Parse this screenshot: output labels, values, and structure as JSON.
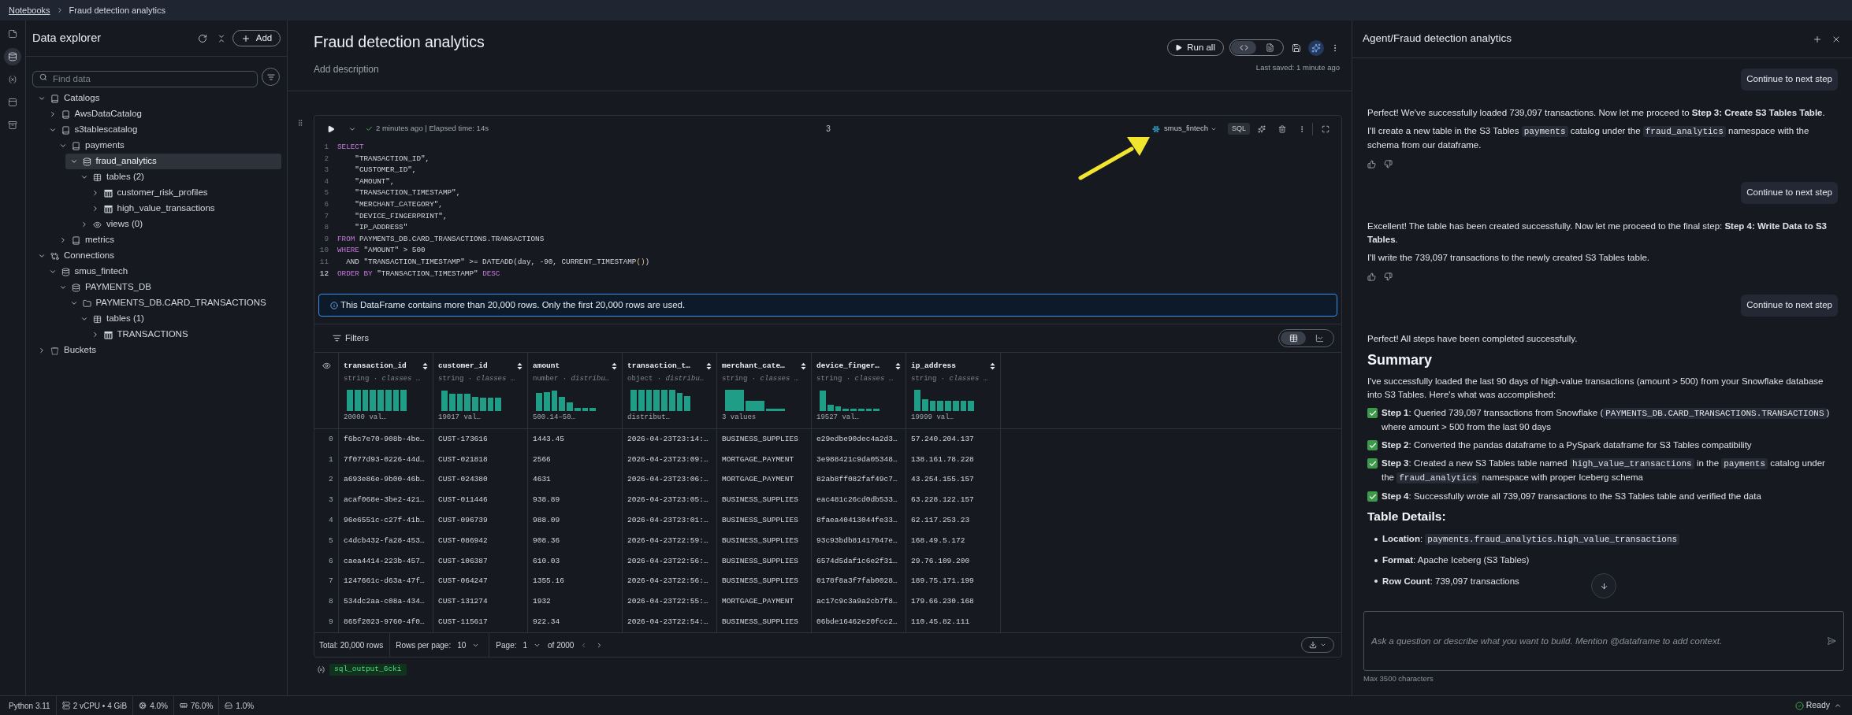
{
  "breadcrumb": [
    {
      "kind": "link",
      "label": "Notebooks"
    },
    {
      "kind": "current",
      "label": "Fraud detection analytics"
    }
  ],
  "rail": [
    {
      "selected": false
    },
    {
      "selected": true
    },
    {
      "selected": false
    },
    {
      "selected": false
    },
    {
      "selected": false
    }
  ],
  "explorer": {
    "title": "Data explorer",
    "add_button": "Add",
    "search": {
      "placeholder": "Find data"
    },
    "tree": [
      {
        "kind": "catalog",
        "label": "Catalogs",
        "expanded": true,
        "selected": false,
        "children": [
          {
            "kind": "catalog",
            "label": "AwsDataCatalog",
            "expanded": false,
            "selected": false
          },
          {
            "kind": "catalog",
            "label": "s3tablescatalog",
            "expanded": true,
            "selected": false,
            "children": [
              {
                "kind": "catalog",
                "label": "payments",
                "expanded": true,
                "selected": false,
                "children": [
                  {
                    "kind": "database",
                    "label": "fraud_analytics",
                    "expanded": true,
                    "selected": true,
                    "children": [
                      {
                        "kind": "table-group",
                        "label": "tables (2)",
                        "expanded": true,
                        "selected": false,
                        "children": [
                          {
                            "kind": "table",
                            "label": "customer_risk_profiles",
                            "expanded": false,
                            "selected": false
                          },
                          {
                            "kind": "table",
                            "label": "high_value_transactions",
                            "expanded": false,
                            "selected": false
                          }
                        ]
                      },
                      {
                        "kind": "view-group",
                        "label": "views (0)",
                        "expanded": false,
                        "selected": false
                      }
                    ]
                  }
                ]
              },
              {
                "kind": "catalog",
                "label": "metrics",
                "expanded": false,
                "selected": false
              }
            ]
          }
        ]
      },
      {
        "kind": "connection-group",
        "label": "Connections",
        "expanded": true,
        "selected": false,
        "children": [
          {
            "kind": "database",
            "label": "smus_fintech",
            "expanded": true,
            "selected": false,
            "children": [
              {
                "kind": "database",
                "label": "PAYMENTS_DB",
                "expanded": true,
                "selected": false,
                "children": [
                  {
                    "kind": "schema",
                    "label": "PAYMENTS_DB.CARD_TRANSACTIONS",
                    "expanded": true,
                    "selected": false,
                    "children": [
                      {
                        "kind": "table-group",
                        "label": "tables (1)",
                        "expanded": true,
                        "selected": false,
                        "children": [
                          {
                            "kind": "table",
                            "label": "TRANSACTIONS",
                            "expanded": false,
                            "selected": false
                          }
                        ]
                      }
                    ]
                  }
                ]
              }
            ]
          }
        ]
      },
      {
        "kind": "bucket-group",
        "label": "Buckets",
        "expanded": false,
        "selected": false
      }
    ]
  },
  "notebook": {
    "title": "Fraud detection analytics",
    "add_description": "Add description",
    "run_all": "Run all",
    "view_modes": [
      {
        "kind": "code",
        "selected": true
      },
      {
        "kind": "document",
        "selected": false
      }
    ],
    "last_saved": "Last saved: 1 minute ago",
    "cell": {
      "status": "2 minutes ago | Elapsed time: 14s",
      "execution_count": "3",
      "connection": "smus_fintech",
      "language": "SQL",
      "code": [
        {
          "number": "1",
          "active": false,
          "tokens": [
            {
              "kind": "keyword",
              "text": "SELECT"
            }
          ]
        },
        {
          "number": "2",
          "active": false,
          "tokens": [
            {
              "kind": "plain",
              "text": "    \"TRANSACTION_ID\","
            }
          ]
        },
        {
          "number": "3",
          "active": false,
          "tokens": [
            {
              "kind": "plain",
              "text": "    \"CUSTOMER_ID\","
            }
          ]
        },
        {
          "number": "4",
          "active": false,
          "tokens": [
            {
              "kind": "plain",
              "text": "    \"AMOUNT\","
            }
          ]
        },
        {
          "number": "5",
          "active": false,
          "tokens": [
            {
              "kind": "plain",
              "text": "    \"TRANSACTION_TIMESTAMP\","
            }
          ]
        },
        {
          "number": "6",
          "active": false,
          "tokens": [
            {
              "kind": "plain",
              "text": "    \"MERCHANT_CATEGORY\","
            }
          ]
        },
        {
          "number": "7",
          "active": false,
          "tokens": [
            {
              "kind": "plain",
              "text": "    \"DEVICE_FINGERPRINT\","
            }
          ]
        },
        {
          "number": "8",
          "active": false,
          "tokens": [
            {
              "kind": "plain",
              "text": "    \"IP_ADDRESS\""
            }
          ]
        },
        {
          "number": "9",
          "active": false,
          "tokens": [
            {
              "kind": "keyword",
              "text": "FROM"
            },
            {
              "kind": "plain",
              "text": " PAYMENTS_DB.CARD_TRANSACTIONS.TRANSACTIONS"
            }
          ]
        },
        {
          "number": "10",
          "active": false,
          "tokens": [
            {
              "kind": "keyword",
              "text": "WHERE"
            },
            {
              "kind": "plain",
              "text": " \"AMOUNT\" > 500"
            }
          ]
        },
        {
          "number": "11",
          "active": false,
          "tokens": [
            {
              "kind": "plain",
              "text": "  AND \"TRANSACTION_TIMESTAMP\" >= DATEADD(day, -90, CURRENT_TIMESTAMP"
            },
            {
              "kind": "bracket",
              "text": "()"
            },
            {
              "kind": "plain",
              "text": ")"
            }
          ]
        },
        {
          "number": "12",
          "active": true,
          "tokens": [
            {
              "kind": "keyword",
              "text": "ORDER BY"
            },
            {
              "kind": "plain",
              "text": " \"TRANSACTION_TIMESTAMP\" "
            },
            {
              "kind": "keyword",
              "text": "DESC"
            }
          ]
        }
      ],
      "banner": "This DataFrame contains more than 20,000 rows. Only the first 20,000 rows are used.",
      "filters": "Filters",
      "output_views": [
        {
          "kind": "table",
          "selected": true
        },
        {
          "kind": "chart",
          "selected": false
        }
      ],
      "columns": [
        {
          "name": "transaction_id",
          "type": "string · *classes* …",
          "summary": "20000 val…"
        },
        {
          "name": "customer_id",
          "type": "string · *classes* …",
          "summary": "19017 val…"
        },
        {
          "name": "amount",
          "type": "number · *distribu…*",
          "summary": "500.14–50…"
        },
        {
          "name": "transaction_t…",
          "type": "object · *distribu…*",
          "summary": "distribut…"
        },
        {
          "name": "merchant_cate…",
          "type": "string · *classes* …",
          "summary": "3 values"
        },
        {
          "name": "device_finger…",
          "type": "string · *classes* …",
          "summary": "19527 val…"
        },
        {
          "name": "ip_address",
          "type": "string · *classes* …",
          "summary": "19999 val…"
        }
      ],
      "rows": [
        {
          "index": "0",
          "cells": [
            "f6bc7e70-908b-4be…",
            "CUST-173616",
            "1443.45",
            "2026-04-23T23:14:…",
            "BUSINESS_SUPPLIES",
            "e29edbe90dec4a2d3…",
            "57.240.204.137"
          ]
        },
        {
          "index": "1",
          "cells": [
            "7f077d93-0226-44d…",
            "CUST-021818",
            "2566",
            "2026-04-23T23:09:…",
            "MORTGAGE_PAYMENT",
            "3e988421c9da05348…",
            "138.161.78.228"
          ]
        },
        {
          "index": "2",
          "cells": [
            "a693e86e-9b00-46b…",
            "CUST-024380",
            "4631",
            "2026-04-23T23:06:…",
            "MORTGAGE_PAYMENT",
            "82ab8ff082faf49c7…",
            "43.254.155.157"
          ]
        },
        {
          "index": "3",
          "cells": [
            "acaf068e-3be2-421…",
            "CUST-011446",
            "938.89",
            "2026-04-23T23:05:…",
            "BUSINESS_SUPPLIES",
            "eac481c26cd0db533…",
            "63.228.122.157"
          ]
        },
        {
          "index": "4",
          "cells": [
            "96e6551c-c27f-41b…",
            "CUST-096739",
            "988.09",
            "2026-04-23T23:01:…",
            "BUSINESS_SUPPLIES",
            "8faea40413044fe33…",
            "62.117.253.23"
          ]
        },
        {
          "index": "5",
          "cells": [
            "c4dcb432-fa28-453…",
            "CUST-086942",
            "908.36",
            "2026-04-23T22:59:…",
            "BUSINESS_SUPPLIES",
            "93c93bdb81417047e…",
            "168.49.5.172"
          ]
        },
        {
          "index": "6",
          "cells": [
            "caea4414-223b-457…",
            "CUST-106387",
            "610.03",
            "2026-04-23T22:56:…",
            "BUSINESS_SUPPLIES",
            "6574d5daf1c6e2f31…",
            "29.76.109.200"
          ]
        },
        {
          "index": "7",
          "cells": [
            "1247661c-d63a-47f…",
            "CUST-064247",
            "1355.16",
            "2026-04-23T22:56:…",
            "BUSINESS_SUPPLIES",
            "0178f8a3f7fab0028…",
            "189.75.171.199"
          ]
        },
        {
          "index": "8",
          "cells": [
            "534dc2aa-c08a-434…",
            "CUST-131274",
            "1932",
            "2026-04-23T22:55:…",
            "MORTGAGE_PAYMENT",
            "ac17c9c3a9a2cb7f8…",
            "179.66.230.168"
          ]
        },
        {
          "index": "9",
          "cells": [
            "865f2023-9760-4f0…",
            "CUST-115617",
            "922.34",
            "2026-04-23T22:54:…",
            "BUSINESS_SUPPLIES",
            "06bde16462e20fcc2…",
            "110.45.82.111"
          ]
        }
      ],
      "footer": {
        "total": "Total: 20,000 rows",
        "rows_per_page_label": "Rows per page:",
        "rows_per_page": "10",
        "page_label": "Page:",
        "page": "1",
        "page_count": "of 2000"
      },
      "output_variable": "sql_output_6cki"
    }
  },
  "agent": {
    "title": "Agent/Fraud detection analytics",
    "messages": [
      {
        "kind": "user",
        "text": "Continue to next step"
      },
      {
        "kind": "assistant",
        "blocks": [
          {
            "kind": "paragraph",
            "segments": [
              {
                "kind": "text",
                "text": "Perfect! We've successfully loaded 739,097 transactions. Now let me proceed to **Step 3: Create S3 Tables Table**."
              }
            ]
          },
          {
            "kind": "paragraph",
            "segments": [
              {
                "kind": "text",
                "text": "I'll create a new table in the S3 Tables "
              },
              {
                "kind": "code",
                "text": "payments"
              },
              {
                "kind": "text",
                "text": " catalog under the "
              },
              {
                "kind": "code",
                "text": "fraud_analytics"
              },
              {
                "kind": "text",
                "text": " namespace with the schema from our dataframe."
              }
            ]
          },
          {
            "kind": "feedback"
          }
        ]
      },
      {
        "kind": "user",
        "text": "Continue to next step"
      },
      {
        "kind": "assistant",
        "blocks": [
          {
            "kind": "paragraph",
            "segments": [
              {
                "kind": "text",
                "text": "Excellent! The table has been created successfully. Now let me proceed to the final step: **Step 4: Write Data to S3 Tables**."
              }
            ]
          },
          {
            "kind": "paragraph",
            "segments": [
              {
                "kind": "text",
                "text": "I'll write the 739,097 transactions to the newly created S3 Tables table."
              }
            ]
          },
          {
            "kind": "feedback"
          }
        ]
      },
      {
        "kind": "user",
        "text": "Continue to next step"
      },
      {
        "kind": "assistant",
        "blocks": [
          {
            "kind": "paragraph",
            "segments": [
              {
                "kind": "text",
                "text": "Perfect! All steps have been completed successfully."
              }
            ]
          },
          {
            "kind": "heading",
            "text": "Summary"
          },
          {
            "kind": "paragraph",
            "segments": [
              {
                "kind": "text",
                "text": "I've successfully loaded the last 90 days of high-value transactions (amount > 500) from your Snowflake database into S3 Tables. Here's what was accomplished:"
              }
            ]
          },
          {
            "kind": "check",
            "segments": [
              {
                "kind": "text",
                "text": "**Step 1**: Queried 739,097 transactions from Snowflake ("
              },
              {
                "kind": "code",
                "text": "PAYMENTS_DB.CARD_TRANSACTIONS.TRANSACTIONS"
              },
              {
                "kind": "text",
                "text": ") where amount > 500 from the last 90 days"
              }
            ]
          },
          {
            "kind": "check",
            "segments": [
              {
                "kind": "text",
                "text": "**Step 2**: Converted the pandas dataframe to a PySpark dataframe for S3 Tables compatibility"
              }
            ]
          },
          {
            "kind": "check",
            "segments": [
              {
                "kind": "text",
                "text": "**Step 3**: Created a new S3 Tables table named "
              },
              {
                "kind": "code",
                "text": "high_value_transactions"
              },
              {
                "kind": "text",
                "text": " in the "
              },
              {
                "kind": "code",
                "text": "payments"
              },
              {
                "kind": "text",
                "text": " catalog under the "
              },
              {
                "kind": "code",
                "text": "fraud_analytics"
              },
              {
                "kind": "text",
                "text": " namespace with proper Iceberg schema"
              }
            ]
          },
          {
            "kind": "check",
            "segments": [
              {
                "kind": "text",
                "text": "**Step 4**: Successfully wrote all 739,097 transactions to the S3 Tables table and verified the data"
              }
            ]
          },
          {
            "kind": "subheading",
            "text": "Table Details:"
          },
          {
            "kind": "bullet",
            "segments": [
              {
                "kind": "text",
                "text": "**Location**: "
              },
              {
                "kind": "code",
                "text": "payments.fraud_analytics.high_value_transactions"
              }
            ]
          },
          {
            "kind": "bullet",
            "segments": [
              {
                "kind": "text",
                "text": "**Format**: Apache Iceberg (S3 Tables)"
              }
            ]
          },
          {
            "kind": "bullet",
            "segments": [
              {
                "kind": "text",
                "text": "**Row Count**: 739,097 transactions"
              }
            ]
          }
        ]
      }
    ],
    "input": {
      "placeholder": "Ask a question or describe what you want to build. Mention @dataframe to add context."
    },
    "limit": "Max 3500 characters"
  },
  "status_bar": {
    "items": [
      {
        "kind": "runtime",
        "text": "Python 3.11"
      },
      {
        "kind": "compute",
        "text": "2 vCPU • 4 GiB"
      },
      {
        "kind": "cpu",
        "text": "4.0%"
      },
      {
        "kind": "memory",
        "text": "76.0%"
      },
      {
        "kind": "disk",
        "text": "1.0%"
      }
    ],
    "kernel": "Ready"
  }
}
